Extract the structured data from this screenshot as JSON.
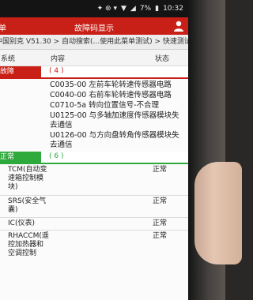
{
  "status_bar": {
    "time": "10:32",
    "battery": "7%",
    "indicators": "✦ ⊛ ▾"
  },
  "titlebar": {
    "menu_label": "菜单",
    "title": "故障码显示"
  },
  "breadcrumb": "中国别克 V51.30 > 自动搜索(...使用此菜单测试) > 快速测试",
  "columns": {
    "system": "系统",
    "content": "内容",
    "status": "状态"
  },
  "fault_section": {
    "label": "故障",
    "count": "( 4 )"
  },
  "fault_codes": [
    "C0035-00 左前车轮转速传感器电路",
    "C0040-00 右前车轮转速传感器电路",
    "C0710-5a 转向位置信号-不合理",
    "U0125-00 与多轴加速度传感器模块失去通信",
    "U0126-00 与方向盘转角传感器模块失去通信"
  ],
  "normal_section": {
    "label": "正常",
    "count": "( 6 )"
  },
  "systems": [
    {
      "name": "TCM(自动变速箱控制模块)",
      "status": "正常"
    },
    {
      "name": "SRS(安全气囊)",
      "status": "正常"
    },
    {
      "name": "IC(仪表)",
      "status": "正常"
    },
    {
      "name": "RHACCM(遥控加热器和空调控制",
      "status": "正常"
    }
  ],
  "colors": {
    "header_red": "#c82016",
    "normal_green": "#2eaa3c"
  }
}
